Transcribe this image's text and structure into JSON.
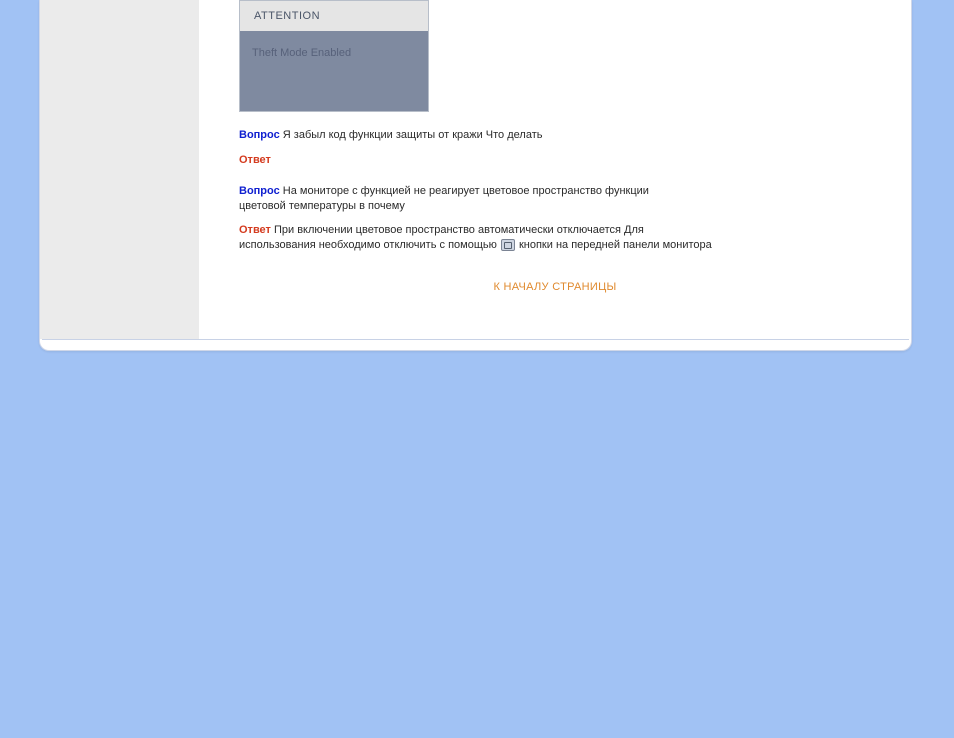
{
  "attention": {
    "header": "ATTENTION",
    "body": "Theft Mode Enabled"
  },
  "qa": [
    {
      "q_label": "Вопрос",
      "q_text_parts": [
        "   Я забыл        код функции защиты от кражи  Что делать"
      ],
      "a_label": "Ответ",
      "a_text_parts": [
        ""
      ]
    },
    {
      "q_label": "Вопрос",
      "q_text_parts": [
        "   На мониторе с функцией                не реагирует цветовое пространство           функции"
      ],
      "q_cont": "цветовой температуры в                   почему",
      "a_label": "Ответ",
      "a_text_parts": [
        " При включении                  цветовое пространство          автоматически отключается  Для"
      ],
      "a_cont_before": "использования           необходимо отключить                 с помощью ",
      "a_cont_after": " кнопки на передней панели монитора"
    }
  ],
  "back_link": "К НАЧАЛУ СТРАНИЦЫ"
}
